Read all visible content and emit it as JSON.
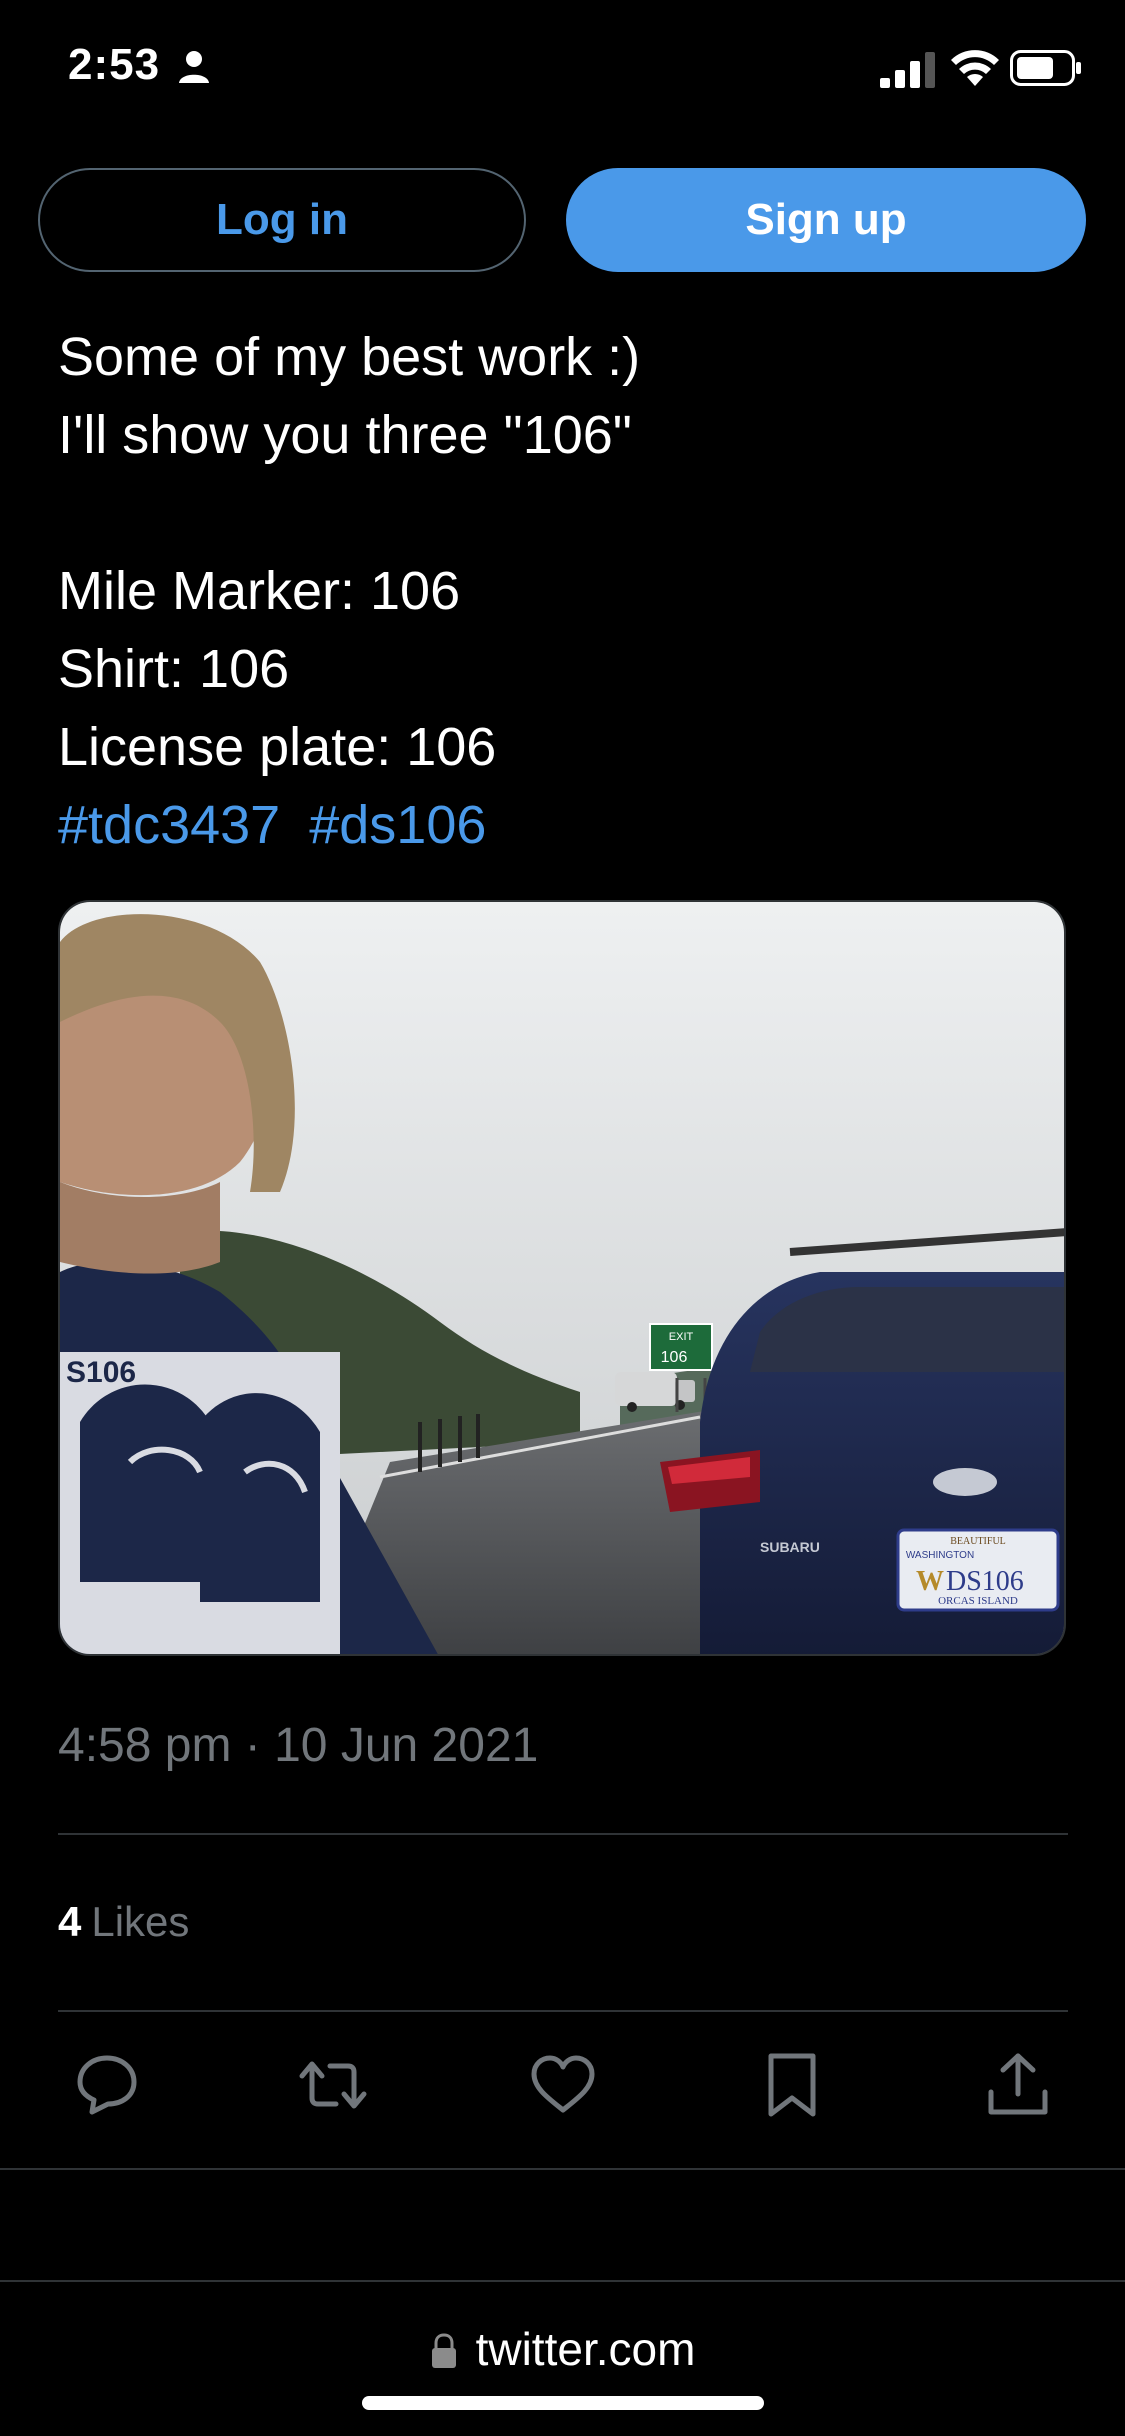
{
  "status_bar": {
    "time": "2:53",
    "icons": [
      "person-icon",
      "signal-icon",
      "wifi-icon",
      "battery-icon"
    ]
  },
  "auth": {
    "login_label": "Log in",
    "signup_label": "Sign up"
  },
  "tweet": {
    "text": "Some of my best work :)\nI'll show you three \"106\"\n\nMile Marker: 106\nShirt: 106\nLicense plate: 106",
    "hashtags": [
      "#tdc3437",
      "#ds106"
    ],
    "timestamp": "4:58 pm · 10 Jun 2021",
    "likes_count": "4",
    "likes_label": "Likes"
  },
  "media": {
    "exit_sign_top": "EXIT",
    "exit_sign_number": "106",
    "shirt_text": "S106",
    "car_brand": "SUBARU",
    "plate_top": "BEAUTIFUL",
    "plate_state": "WASHINGTON",
    "plate_letter": "W",
    "plate_number": "DS106",
    "plate_bottom": "ORCAS ISLAND"
  },
  "actions": [
    "reply-icon",
    "retweet-icon",
    "like-icon",
    "bookmark-icon",
    "share-icon"
  ],
  "browser": {
    "url": "twitter.com"
  },
  "colors": {
    "accent": "#4a99e9",
    "background": "#000000",
    "muted": "#71767b",
    "divider": "#2f3336"
  }
}
